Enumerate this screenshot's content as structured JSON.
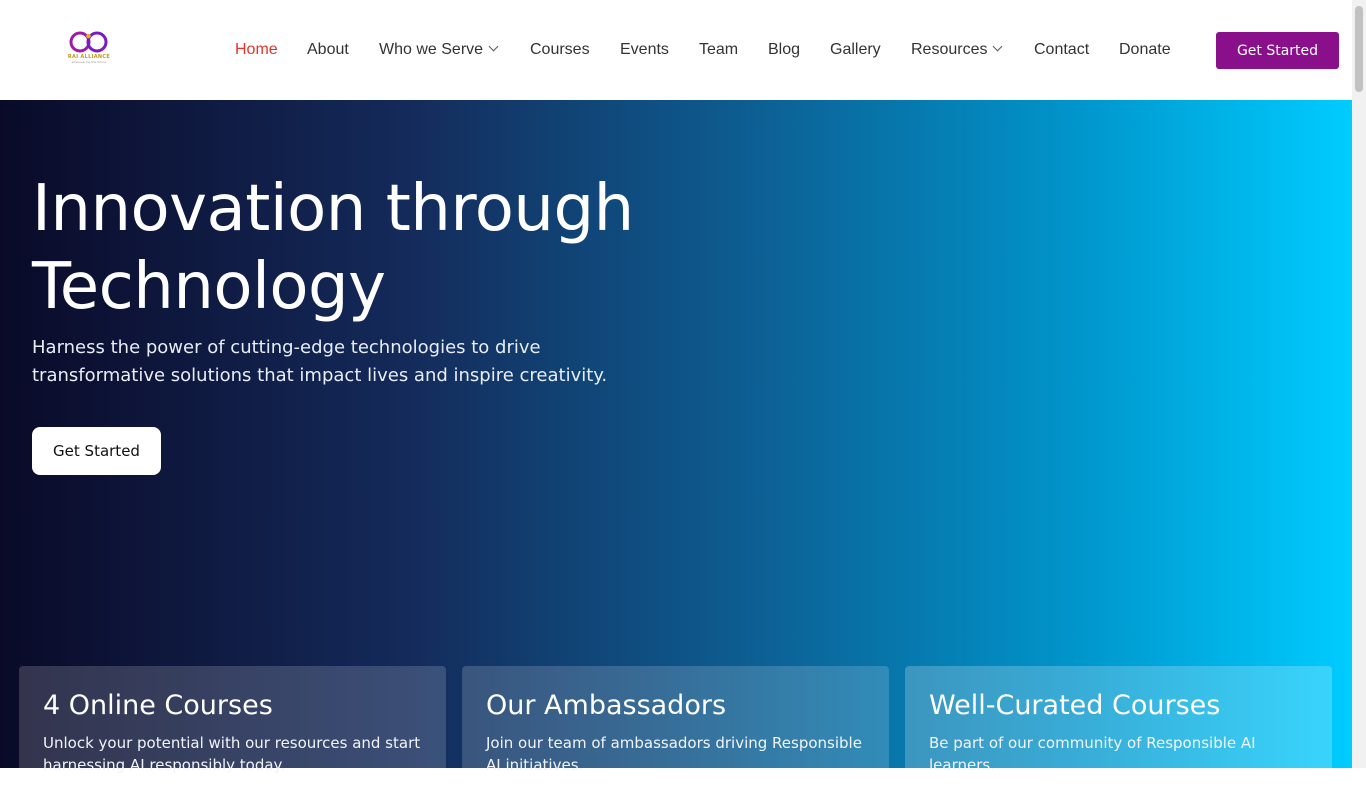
{
  "brand": {
    "logo_text": "RAI ALLIANCE",
    "logo_sub": "empowering the future",
    "colors": {
      "primary": "#8a0f8a",
      "accent_active": "#e5322d"
    }
  },
  "nav": {
    "items": [
      {
        "label": "Home"
      },
      {
        "label": "About"
      },
      {
        "label": "Who we Serve"
      },
      {
        "label": "Courses"
      },
      {
        "label": "Events"
      },
      {
        "label": "Team"
      },
      {
        "label": "Blog"
      },
      {
        "label": "Gallery"
      },
      {
        "label": "Resources"
      },
      {
        "label": "Contact"
      },
      {
        "label": "Donate"
      }
    ],
    "cta_label": "Get Started"
  },
  "hero": {
    "title_line1": "Innovation through",
    "title_line2": "Technology",
    "subtitle": "Harness the power of cutting-edge technologies to drive transformative solutions that impact lives and inspire creativity.",
    "cta_label": "Get Started"
  },
  "cards": [
    {
      "title": "4 Online Courses",
      "text": "Unlock your potential with our resources and start harnessing AI responsibly today."
    },
    {
      "title": "Our Ambassadors",
      "text": "Join our team of ambassadors driving Responsible AI initiatives."
    },
    {
      "title": "Well-Curated Courses",
      "text": "Be part of our community of Responsible AI learners."
    }
  ]
}
